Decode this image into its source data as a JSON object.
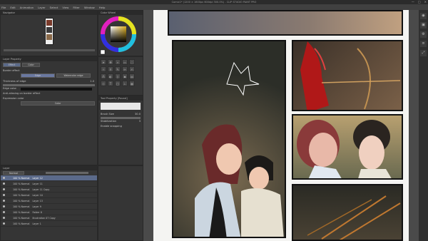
{
  "window": {
    "title": "Comic1* (1200 × 1600px 600dpi 300.0%) - CLIP STUDIO PAINT PRO",
    "controls": [
      "—",
      "□",
      "✕"
    ]
  },
  "menu": [
    "File",
    "Edit",
    "Animation",
    "Layer",
    "Select",
    "View",
    "Filter",
    "Window",
    "Help"
  ],
  "navigator": {
    "title": "Navigator"
  },
  "color_wheel": {
    "title": "Color Wheel"
  },
  "layer_property": {
    "title": "Layer Property",
    "tabs": [
      "Effect",
      "Color"
    ],
    "border_effect_label": "Border effect",
    "border_btn": "Edge",
    "watercolor_btn": "Watercolor edge",
    "thickness_label": "Thickness of edge",
    "thickness_value": "1.0",
    "edge_color_label": "Edge color",
    "anti_alias_label": "Anti-aliasing on border effect",
    "expression_label": "Expression color",
    "expression_value": "Color"
  },
  "tools": {
    "icons": [
      "cursor",
      "move",
      "zoom",
      "select",
      "lasso",
      "wand",
      "eyedrop",
      "pen",
      "pencil",
      "brush",
      "spray",
      "blend",
      "eraser",
      "fill",
      "gradient",
      "figure",
      "text",
      "balloon",
      "ruler",
      "frame"
    ]
  },
  "tool_property": {
    "title": "Tool Property [Round]",
    "brush_size_label": "Brush Size",
    "brush_size_value": "30.0",
    "stabilization_label": "Stabilization",
    "stabilization_value": "3",
    "snapping_label": "Enable snapping"
  },
  "layers": {
    "title": "Layer",
    "blend_mode": "Normal",
    "items": [
      {
        "name": "100 % Normal",
        "sub": "Layer 12",
        "selected": true
      },
      {
        "name": "100 % Normal",
        "sub": "Layer 11"
      },
      {
        "name": "100 % Normal",
        "sub": "Layer 11 Copy"
      },
      {
        "name": "100 % Normal",
        "sub": "Layer 10"
      },
      {
        "name": "100 % Normal",
        "sub": "Layer 13"
      },
      {
        "name": "100 % Normal",
        "sub": "Layer 9"
      },
      {
        "name": "100 % Normal",
        "sub": "Folder 8"
      },
      {
        "name": "100 % Normal",
        "sub": "Illustration 07 Copy"
      },
      {
        "name": "100 % Normal",
        "sub": "Layer 1"
      }
    ]
  },
  "right_bar": {
    "icons": [
      "camera",
      "object",
      "gear",
      "menu",
      "expand"
    ]
  },
  "colors": {
    "accent": "#5b6a8a",
    "canvas_bg": "#4a4a4a",
    "page": "#f4f4f2"
  }
}
